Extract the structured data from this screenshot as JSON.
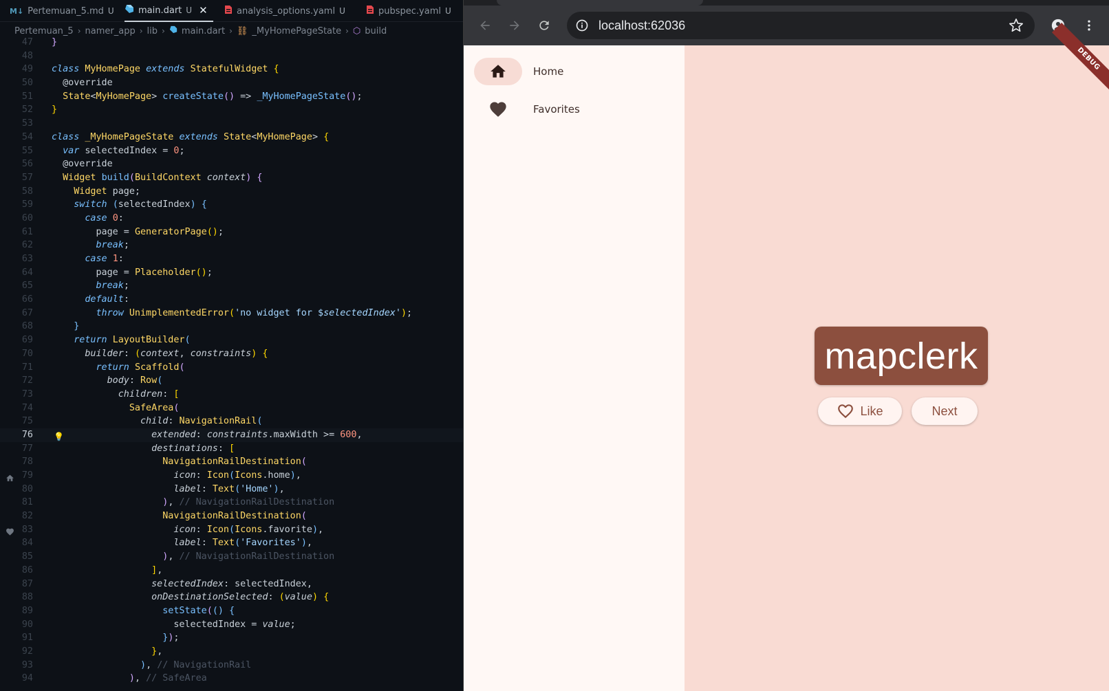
{
  "editor": {
    "tabs": [
      {
        "icon": "markdown-icon",
        "label": "Pertemuan_5.md",
        "status": "U"
      },
      {
        "icon": "dart-icon",
        "label": "main.dart",
        "status": "U"
      },
      {
        "icon": "yaml-icon",
        "label": "analysis_options.yaml",
        "status": "U"
      },
      {
        "icon": "yaml-icon",
        "label": "pubspec.yaml",
        "status": "U"
      }
    ],
    "breadcrumb": [
      "Pertemuan_5",
      "namer_app",
      "lib",
      "main.dart",
      "_MyHomePageState",
      "build"
    ],
    "current_line": "76"
  },
  "browser": {
    "url": "localhost:62036"
  },
  "app": {
    "rail": [
      {
        "icon": "home-icon",
        "label": "Home",
        "selected": true
      },
      {
        "icon": "favorite-icon",
        "label": "Favorites",
        "selected": false
      }
    ],
    "word": "mapclerk",
    "like_label": "Like",
    "next_label": "Next",
    "debug_banner": "DEBUG",
    "colors": {
      "primary": "#8c4f3e",
      "background": "#f9dbd3",
      "rail_background": "#fff8f5"
    }
  }
}
